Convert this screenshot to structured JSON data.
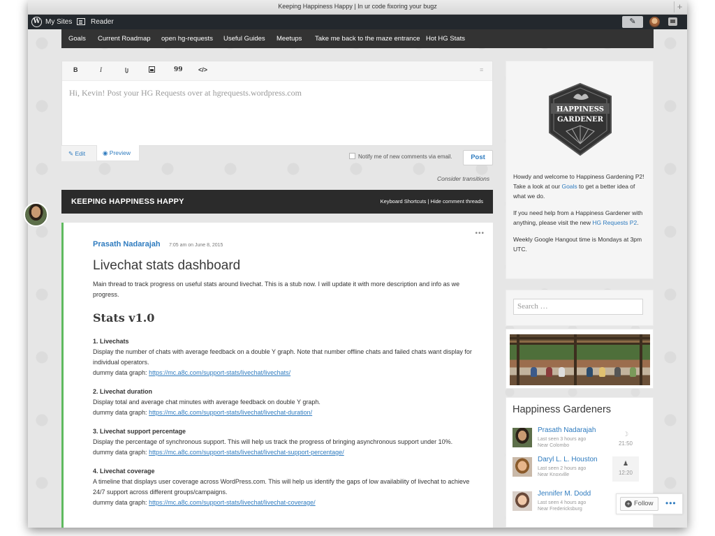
{
  "window": {
    "title": "Keeping Happiness Happy | In ur code fixoring your bugz"
  },
  "adminbar": {
    "my_sites": "My Sites",
    "reader": "Reader"
  },
  "nav": {
    "items": [
      "Goals",
      "Current Roadmap",
      "open hg-requests",
      "Useful Guides",
      "Meetups",
      "Take me back to the maze entrance",
      "Hot HG Stats"
    ]
  },
  "editor": {
    "toolbar": {
      "bold": "B",
      "italic": "I",
      "link": "",
      "image": "",
      "quote": "99",
      "code": "</>"
    },
    "prompt": "Hi, Kevin! Post your HG Requests over at hgrequests.wordpress.com",
    "tab_edit": "Edit",
    "tab_preview": "Preview",
    "notify_label": "Notify me of new comments via email.",
    "post_button": "Post",
    "consider": "Consider transitions"
  },
  "site_header": {
    "name": "KEEPING HAPPINESS HAPPY",
    "links": "Keyboard Shortcuts | Hide comment threads"
  },
  "post": {
    "author": "Prasath Nadarajah",
    "timestamp": "7:05 am on June 8, 2015",
    "title": "Livechat stats dashboard",
    "intro": "Main thread to track progress on useful stats around livechat. This is a stub now. I will update it with more description and info as we progress.",
    "stats_heading": "Stats v1.0",
    "sections": [
      {
        "title": "1. Livechats",
        "desc": "Display the number of chats with average feedback on a double Y graph. Note that number offline chats and failed chats want display for individual operators.",
        "label": "dummy data graph:",
        "link": "https://mc.a8c.com/support-stats/livechat/livechats/"
      },
      {
        "title": "2. Livechat duration",
        "desc": "Display total and average chat minutes with average feedback on double Y graph.",
        "label": "dummy data graph:",
        "link": "https://mc.a8c.com/support-stats/livechat/livechat-duration/"
      },
      {
        "title": "3. Livechat support percentage",
        "desc": "Display the percentage of synchronous support. This will help us track the progress of bringing asynchronous support under 10%.",
        "label": "dummy data graph:",
        "link": "https://mc.a8c.com/support-stats/livechat/livechat-support-percentage/"
      },
      {
        "title": "4. Livechat coverage",
        "desc": "A timeline that displays user coverage across WordPress.com. This will help us identify the gaps of low availability of livechat to achieve 24/7 support across different groups/campaigns.",
        "label": "dummy data graph:",
        "link": "https://mc.a8c.com/support-stats/livechat/livechat-coverage/"
      }
    ]
  },
  "sidebar": {
    "badge": {
      "line1": "HAPPINESS",
      "line2": "GARDENER"
    },
    "about": {
      "p1_a": "Howdy and welcome to Happiness Gardening P2! Take a look at our ",
      "p1_link": "Goals",
      "p1_b": " to get a better idea of what we do.",
      "p2_a": "If you need help from a Happiness Gardener with anything, please visit the new ",
      "p2_link": "HG Requests P2",
      "p2_b": ".",
      "p3": "Weekly Google Hangout time is Mondays at 3pm UTC."
    },
    "search_placeholder": "Search …",
    "gardeners_title": "Happiness Gardeners",
    "gardeners": [
      {
        "name": "Prasath Nadarajah",
        "seen": "Last seen 3 hours ago",
        "near": "Near Colombo",
        "time": "21:50",
        "icon": "moon-icon"
      },
      {
        "name": "Daryl L. L. Houston",
        "seen": "Last seen 2 hours ago",
        "near": "Near Knoxville",
        "time": "12:20",
        "icon": "person-icon"
      },
      {
        "name": "Jennifer M. Dodd",
        "seen": "Last seen 4 hours ago",
        "near": "Near Fredericksburg",
        "time": "",
        "icon": "person-icon"
      }
    ]
  },
  "followbar": {
    "follow": "Follow",
    "more": "•••"
  },
  "colors": {
    "link": "#2e7bbf",
    "accent_green": "#5fba5f",
    "dark_bar": "#333333",
    "admin_bar": "#23282d"
  }
}
